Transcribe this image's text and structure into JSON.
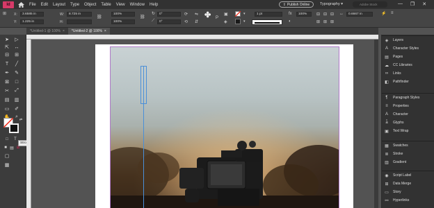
{
  "app": {
    "badge": "Id",
    "menus": [
      "File",
      "Edit",
      "Layout",
      "Type",
      "Object",
      "Table",
      "View",
      "Window",
      "Help"
    ],
    "publish_label": "Publish Online",
    "workspace_label": "Typography",
    "search_placeholder": "Adobe Stock",
    "window_controls": [
      "—",
      "❐",
      "✕"
    ]
  },
  "control_bar": {
    "x_label": "X:",
    "x_value": "3.6585 in",
    "y_label": "Y:",
    "y_value": "1.225 in",
    "w_label": "W:",
    "w_value": "8.725 in",
    "h_label": "H:",
    "h_value": "",
    "scale_x": "100%",
    "scale_y": "100%",
    "angle": "0°",
    "shear": "0°",
    "stroke_weight": "1 pt",
    "percent_field": "100%",
    "gap_value": "0.6667 in"
  },
  "tabs": [
    {
      "label": "*Untitled-1 @ 100%",
      "close": "×"
    },
    {
      "label": "*Untitled-2 @ 100%",
      "close": "×"
    }
  ],
  "tooltip": "Stroke (X)",
  "panels": {
    "group1": [
      {
        "icon": "layers-icon",
        "glyph": "◈",
        "label": "Layers"
      },
      {
        "icon": "character-styles-icon",
        "glyph": "A",
        "label": "Character Styles"
      },
      {
        "icon": "pages-icon",
        "glyph": "▤",
        "label": "Pages"
      },
      {
        "icon": "cc-libraries-icon",
        "glyph": "☁",
        "label": "CC Libraries"
      },
      {
        "icon": "links-icon",
        "glyph": "∞",
        "label": "Links"
      },
      {
        "icon": "pathfinder-icon",
        "glyph": "◧",
        "label": "Pathfinder"
      }
    ],
    "group2": [
      {
        "icon": "paragraph-styles-icon",
        "glyph": "¶",
        "label": "Paragraph Styles"
      },
      {
        "icon": "properties-icon",
        "glyph": "≡",
        "label": "Properties"
      },
      {
        "icon": "character-icon",
        "glyph": "A",
        "label": "Character"
      },
      {
        "icon": "glyphs-icon",
        "glyph": "ǡ",
        "label": "Glyphs"
      },
      {
        "icon": "text-wrap-icon",
        "glyph": "▣",
        "label": "Text Wrap"
      }
    ],
    "group3": [
      {
        "icon": "swatches-icon",
        "glyph": "▦",
        "label": "Swatches"
      },
      {
        "icon": "stroke-icon",
        "glyph": "≣",
        "label": "Stroke"
      },
      {
        "icon": "gradient-icon",
        "glyph": "▥",
        "label": "Gradient"
      }
    ],
    "group4": [
      {
        "icon": "script-label-icon",
        "glyph": "◉",
        "label": "Script Label"
      },
      {
        "icon": "data-merge-icon",
        "glyph": "⊞",
        "label": "Data Merge"
      },
      {
        "icon": "story-icon",
        "glyph": "▭",
        "label": "Story"
      },
      {
        "icon": "hyperlinks-icon",
        "glyph": "⚯",
        "label": "Hyperlinks"
      }
    ]
  },
  "colors": {
    "accent": "#d63a68",
    "selection": "#4a8fd8",
    "margin_guide": "#b07ac9"
  }
}
